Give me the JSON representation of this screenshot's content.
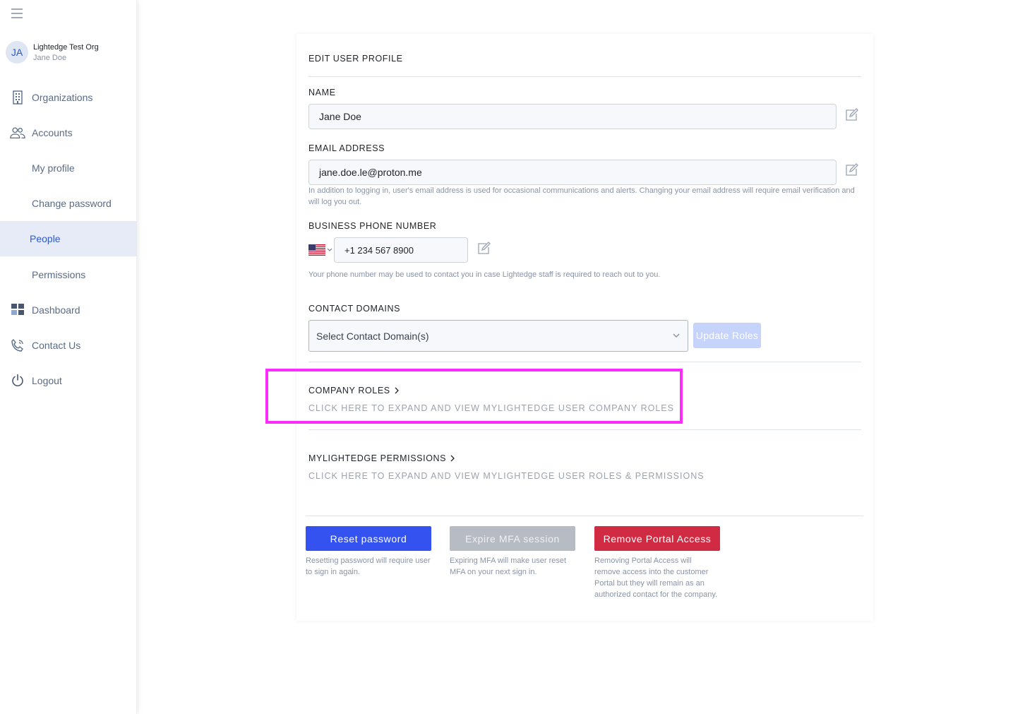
{
  "sidebar": {
    "org_name": "Lightedge Test Org",
    "user_name": "Jane Doe",
    "avatar_initials": "JA",
    "items": [
      {
        "label": "Organizations",
        "icon": "building-icon"
      },
      {
        "label": "Accounts",
        "icon": "users-icon"
      },
      {
        "label": "My profile",
        "icon": ""
      },
      {
        "label": "Change password",
        "icon": ""
      },
      {
        "label": "People",
        "icon": "",
        "active": true
      },
      {
        "label": "Permissions",
        "icon": ""
      },
      {
        "label": "Dashboard",
        "icon": "dashboard-icon"
      },
      {
        "label": "Contact Us",
        "icon": "phone-icon"
      },
      {
        "label": "Logout",
        "icon": "power-icon"
      }
    ]
  },
  "form": {
    "title": "EDIT USER PROFILE",
    "name_label": "NAME",
    "name_value": "Jane Doe",
    "email_label": "EMAIL ADDRESS",
    "email_value": "jane.doe.le@proton.me",
    "email_help": "In addition to logging in, user's email address is used for occasional communications and alerts. Changing your email address will require email verification and will log you out.",
    "phone_label": "BUSINESS PHONE NUMBER",
    "phone_value": "+1 234 567 8900",
    "phone_help": "Your phone number may be used to contact you in case Lightedge staff is required to reach out to you.",
    "domains_label": "CONTACT DOMAINS",
    "domains_placeholder": "Select Contact Domain(s)",
    "update_roles": "Update Roles",
    "company_roles_title": "COMPANY ROLES",
    "company_roles_sub": "CLICK HERE TO EXPAND AND VIEW MYLIGHTEDGE USER COMPANY ROLES",
    "permissions_title": "MYLIGHTEDGE PERMISSIONS",
    "permissions_sub": "CLICK HERE TO EXPAND AND VIEW MYLIGHTEDGE USER ROLES & PERMISSIONS"
  },
  "actions": {
    "reset_label": "Reset password",
    "reset_help": "Resetting password will require user to sign in again.",
    "expire_label": "Expire MFA session",
    "expire_help": "Expiring MFA will make user reset MFA on your next sign in.",
    "remove_label": "Remove Portal Access",
    "remove_help": "Removing Portal Access will remove access into the customer Portal but they will remain as an authorized contact for the company."
  },
  "colors": {
    "primary": "#3452ef",
    "danger": "#d02b42",
    "disabled": "#b7bcc4",
    "highlight": "#ff2cff",
    "active_nav": "#e6ebf7"
  }
}
